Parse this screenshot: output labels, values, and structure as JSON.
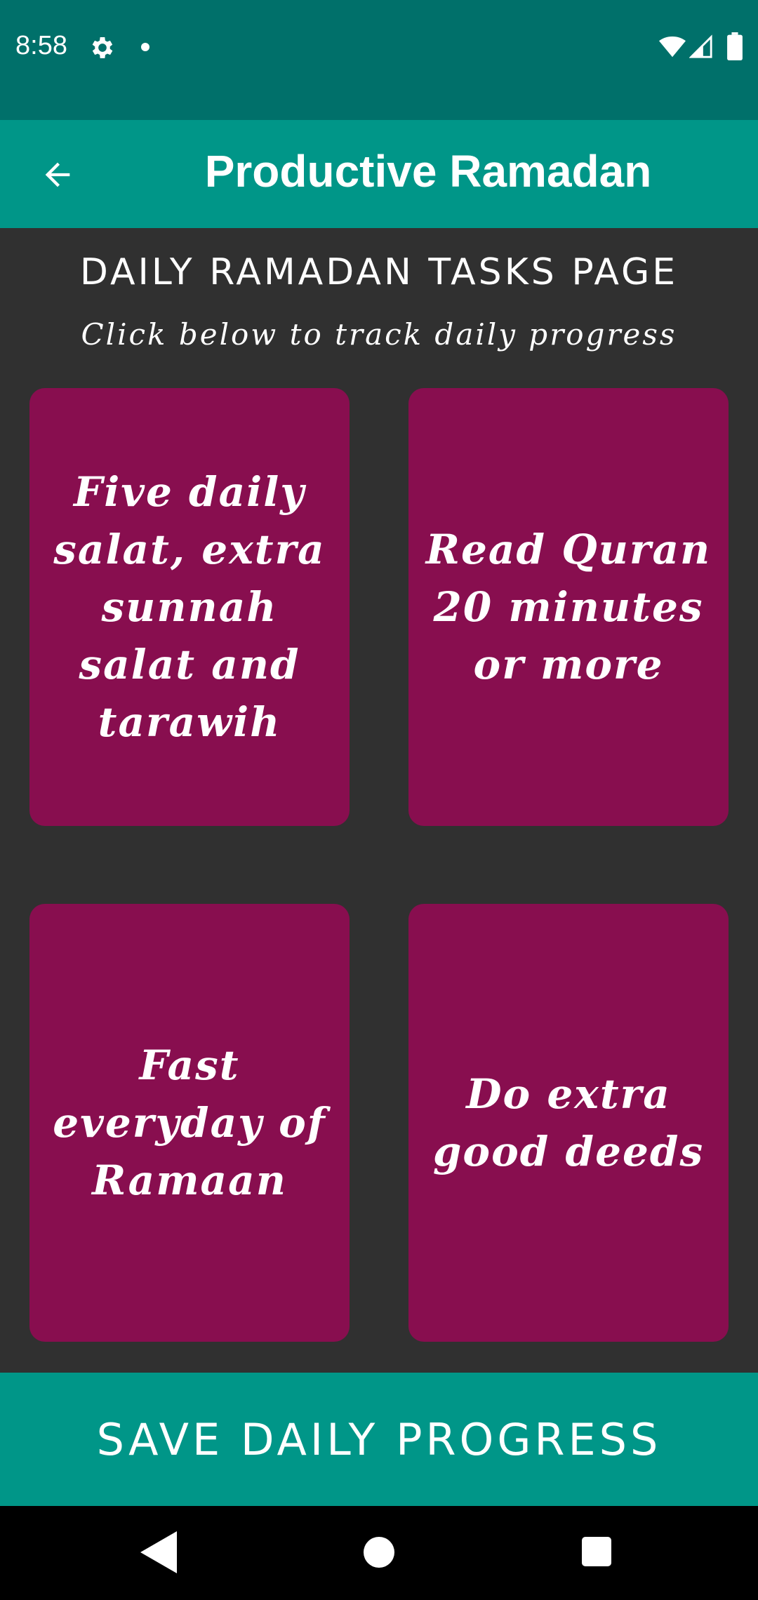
{
  "status_bar": {
    "time": "8:58",
    "icons": [
      "gear-icon",
      "notification-dot-icon",
      "wifi-icon",
      "signal-icon",
      "battery-icon"
    ]
  },
  "app_bar": {
    "title": "Productive Ramadan",
    "back_icon": "arrow-back-icon"
  },
  "page": {
    "heading": "DAILY RAMADAN TASKS PAGE",
    "subheading": "Click below to track daily progress"
  },
  "tasks": [
    {
      "label": "Five daily salat, extra sunnah salat and tarawih"
    },
    {
      "label": "Read Quran 20 minutes or more"
    },
    {
      "label": "Fast everyday of Ramaan"
    },
    {
      "label": "Do extra good deeds"
    }
  ],
  "save_button": {
    "label": "SAVE DAILY PROGRESS"
  },
  "nav_bar": {
    "icons": [
      "back-triangle-icon",
      "home-circle-icon",
      "recents-square-icon"
    ]
  },
  "colors": {
    "status_bar": "#00706a",
    "app_bar": "#009688",
    "background": "#303030",
    "card": "#880e4f",
    "button": "#009688",
    "text": "#ffffff"
  }
}
